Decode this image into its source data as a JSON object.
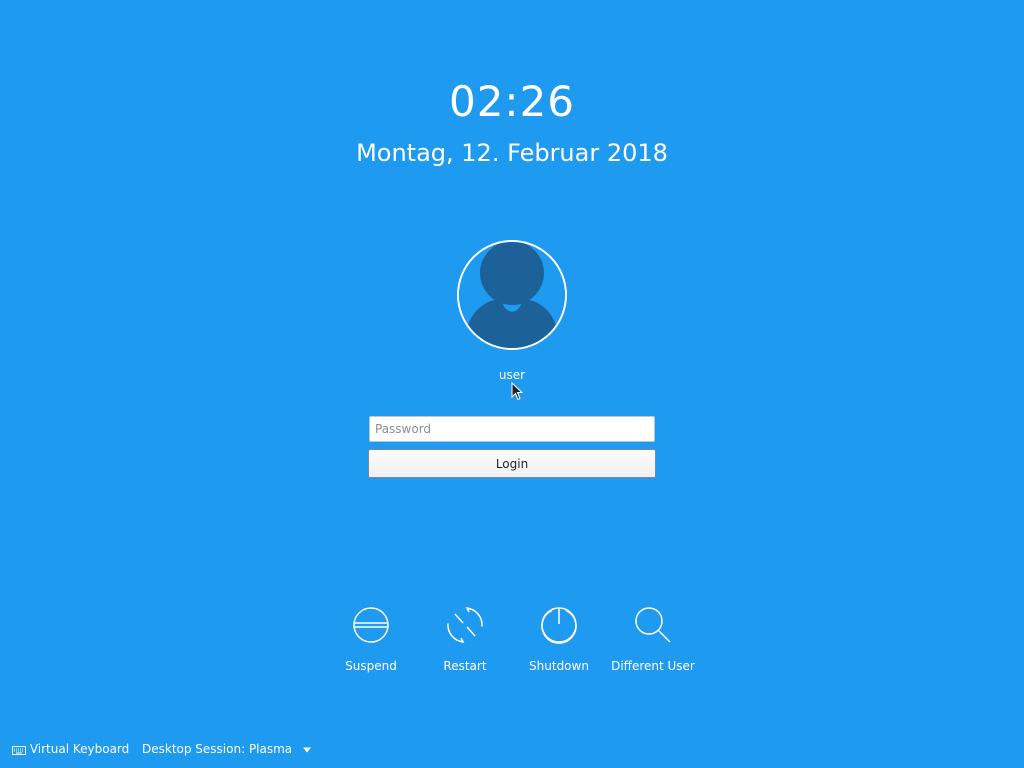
{
  "clock": {
    "time": "02:26"
  },
  "date": {
    "text": "Montag, 12. Februar 2018"
  },
  "user": {
    "name": "user"
  },
  "login_form": {
    "password_placeholder": "Password",
    "password_value": "",
    "login_label": "Login"
  },
  "actions": [
    {
      "label": "Suspend",
      "icon": "suspend-icon"
    },
    {
      "label": "Restart",
      "icon": "restart-icon"
    },
    {
      "label": "Shutdown",
      "icon": "shutdown-icon"
    },
    {
      "label": "Different User",
      "icon": "search-icon"
    }
  ],
  "footer": {
    "virtual_keyboard": {
      "label": "Virtual Keyboard",
      "icon": "keyboard-icon"
    },
    "session": {
      "label": "Desktop Session: Plasma",
      "icon": "dropdown-arrow-icon"
    }
  },
  "colors": {
    "background": "#1e9af0",
    "avatar_fill": "#1d6199",
    "text": "#ffffff"
  }
}
